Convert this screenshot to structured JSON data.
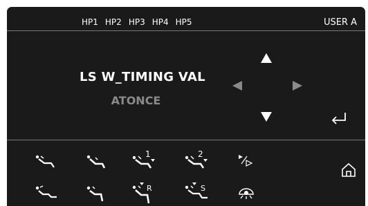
{
  "header": {
    "hp_tabs": [
      "HP1",
      "HP2",
      "HP3",
      "HP4",
      "HP5"
    ],
    "user_label": "USER A"
  },
  "main": {
    "setting_name": "LS W_TIMING VAL",
    "setting_value": "ATONCE"
  },
  "navigation": {
    "up": "arrow-up-icon",
    "down": "arrow-down-icon",
    "left": "arrow-left-icon",
    "right": "arrow-right-icon",
    "enter": "enter-return-icon",
    "home": "home-icon"
  },
  "chair_buttons": {
    "row1": [
      {
        "icon": "chair-recline-a-icon",
        "label": ""
      },
      {
        "icon": "chair-recline-b-icon",
        "label": ""
      },
      {
        "icon": "chair-memory-1-icon",
        "label": "1"
      },
      {
        "icon": "chair-memory-2-icon",
        "label": "2"
      },
      {
        "icon": "play-step-icon",
        "label": ""
      }
    ],
    "row2": [
      {
        "icon": "chair-up-a-icon",
        "label": ""
      },
      {
        "icon": "chair-up-b-icon",
        "label": ""
      },
      {
        "icon": "chair-return-r-icon",
        "label": "R"
      },
      {
        "icon": "chair-spit-s-icon",
        "label": "S"
      },
      {
        "icon": "dental-light-icon",
        "label": ""
      }
    ]
  },
  "colors": {
    "screen_bg": "#1a1a1a",
    "text": "#ffffff",
    "value_text": "#8a8a8a",
    "disabled_arrow": "#8a8a8a",
    "divider": "#7a7a7a"
  }
}
